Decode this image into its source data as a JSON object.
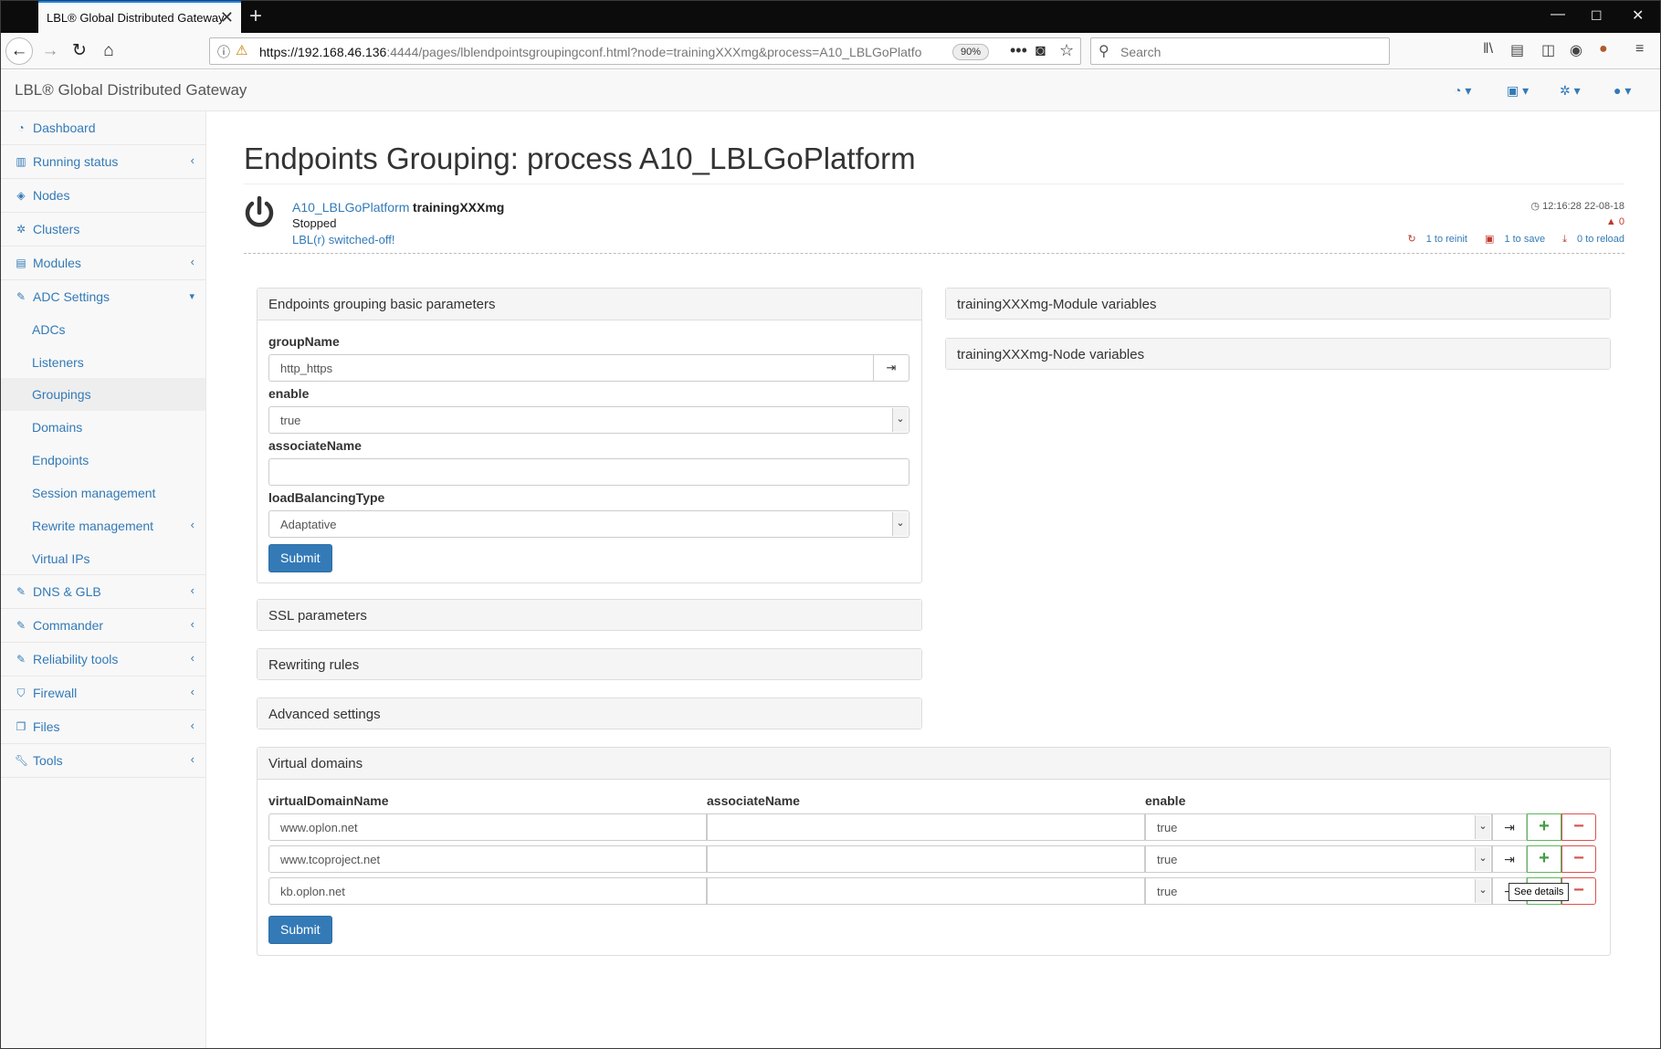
{
  "browser": {
    "tab_title": "LBL® Global Distributed Gateway",
    "url_host": "https://192.168.46.136",
    "url_rest": ":4444/pages/lblendpointsgroupingconf.html?node=trainingXXXmg&process=A10_LBLGoPlatfo",
    "zoom": "90%",
    "search_placeholder": "Search"
  },
  "app": {
    "brand": "LBL® Global Distributed Gateway"
  },
  "sidebar": {
    "items": [
      {
        "label": "Dashboard",
        "icon": "dashboard-icon"
      },
      {
        "label": "Running status",
        "icon": "bar-chart-icon"
      },
      {
        "label": "Nodes",
        "icon": "cube-icon"
      },
      {
        "label": "Clusters",
        "icon": "cogs-icon"
      },
      {
        "label": "Modules",
        "icon": "list-icon"
      },
      {
        "label": "ADC Settings",
        "icon": "edit-icon"
      },
      {
        "label": "DNS & GLB",
        "icon": "edit-icon"
      },
      {
        "label": "Commander",
        "icon": "edit-icon"
      },
      {
        "label": "Reliability tools",
        "icon": "edit-icon"
      },
      {
        "label": "Firewall",
        "icon": "shield-icon"
      },
      {
        "label": "Files",
        "icon": "files-icon"
      },
      {
        "label": "Tools",
        "icon": "wrench-icon"
      }
    ],
    "adc_sub": [
      "ADCs",
      "Listeners",
      "Groupings",
      "Domains",
      "Endpoints",
      "Session management",
      "Rewrite management",
      "Virtual IPs"
    ]
  },
  "header": {
    "title": "Endpoints Grouping: process A10_LBLGoPlatform",
    "process_link": "A10_LBLGoPlatform",
    "node": "trainingXXXmg",
    "status": "Stopped",
    "lbl_status": "LBL(r) switched-off!",
    "time": "12:16:28 22-08-18",
    "warnings": "0",
    "reinit": "1 to reinit",
    "save": "1 to save",
    "reload": "0 to reload"
  },
  "basic": {
    "panel_title": "Endpoints grouping basic parameters",
    "groupName_label": "groupName",
    "groupName_value": "http_https",
    "enable_label": "enable",
    "enable_value": "true",
    "associateName_label": "associateName",
    "associateName_value": "",
    "lb_label": "loadBalancingType",
    "lb_value": "Adaptative",
    "submit": "Submit"
  },
  "collapsed_panels": {
    "ssl": "SSL parameters",
    "rewriting": "Rewriting rules",
    "advanced": "Advanced settings",
    "module_vars": "trainingXXXmg-Module variables",
    "node_vars": "trainingXXXmg-Node variables"
  },
  "virtual_domains": {
    "panel_title": "Virtual domains",
    "col_name": "virtualDomainName",
    "col_assoc": "associateName",
    "col_enable": "enable",
    "rows": [
      {
        "name": "www.oplon.net",
        "assoc": "",
        "enable": "true"
      },
      {
        "name": "www.tcoproject.net",
        "assoc": "",
        "enable": "true"
      },
      {
        "name": "kb.oplon.net",
        "assoc": "",
        "enable": "true"
      }
    ],
    "tooltip": "See details",
    "submit": "Submit"
  }
}
